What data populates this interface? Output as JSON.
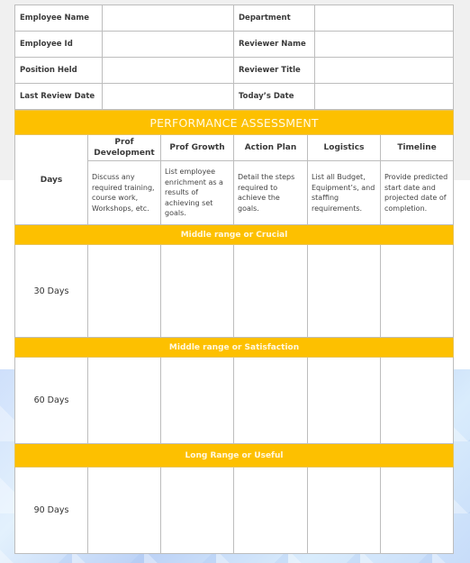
{
  "info": {
    "rows": [
      {
        "left_label": "Employee Name",
        "left_value": "",
        "right_label": "Department",
        "right_value": ""
      },
      {
        "left_label": "Employee Id",
        "left_value": "",
        "right_label": "Reviewer Name",
        "right_value": ""
      },
      {
        "left_label": "Position Held",
        "left_value": "",
        "right_label": "Reviewer Title",
        "right_value": ""
      },
      {
        "left_label": "Last Review Date",
        "left_value": "",
        "right_label": "Today’s Date",
        "right_value": ""
      }
    ]
  },
  "assessment": {
    "title": "PERFORMANCE ASSESSMENT",
    "days_header": "Days",
    "columns": [
      {
        "header": "Prof Development",
        "description": "Discuss any required training, course work, Workshops, etc."
      },
      {
        "header": "Prof Growth",
        "description": "List employee enrichment as a results of achieving set goals."
      },
      {
        "header": "Action Plan",
        "description": "Detail the steps required to achieve the goals."
      },
      {
        "header": "Logistics",
        "description": "List all Budget, Equipment’s, and staffing requirements."
      },
      {
        "header": "Timeline",
        "description": "Provide predicted start date and projected date of completion."
      }
    ],
    "sections": [
      {
        "title": "Middle range or Crucial",
        "days": "30 Days",
        "cells": [
          "",
          "",
          "",
          "",
          ""
        ]
      },
      {
        "title": "Middle range or Satisfaction",
        "days": "60 Days",
        "cells": [
          "",
          "",
          "",
          "",
          ""
        ]
      },
      {
        "title": "Long Range or Useful",
        "days": "90 Days",
        "cells": [
          "",
          "",
          "",
          "",
          ""
        ]
      }
    ]
  },
  "colors": {
    "accent": "#fdc000",
    "border": "#bdbdbd"
  }
}
